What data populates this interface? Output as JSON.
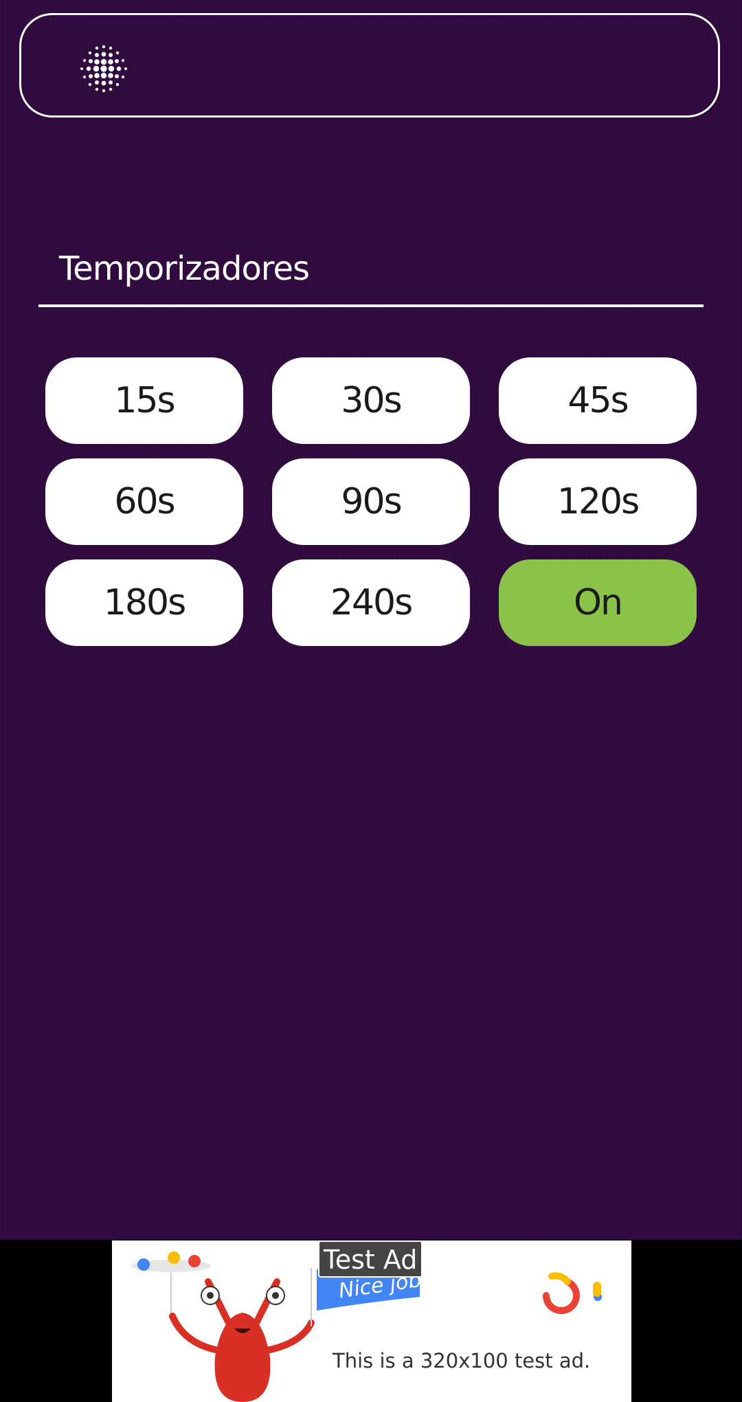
{
  "header": {
    "icon": "dotted-circle-icon"
  },
  "section": {
    "title": "Temporizadores"
  },
  "timers": [
    {
      "label": "15s",
      "selected": false
    },
    {
      "label": "30s",
      "selected": false
    },
    {
      "label": "45s",
      "selected": false
    },
    {
      "label": "60s",
      "selected": false
    },
    {
      "label": "90s",
      "selected": false
    },
    {
      "label": "120s",
      "selected": false
    },
    {
      "label": "180s",
      "selected": false
    },
    {
      "label": "240s",
      "selected": false
    },
    {
      "label": "On",
      "selected": true
    }
  ],
  "ad": {
    "badge": "Test Ad",
    "banner": "Nice job!",
    "text": "This is a 320x100 test ad."
  },
  "colors": {
    "background": "#300a3e",
    "button": "#ffffff",
    "button_active": "#8bc34a",
    "outline": "#ffffff"
  }
}
